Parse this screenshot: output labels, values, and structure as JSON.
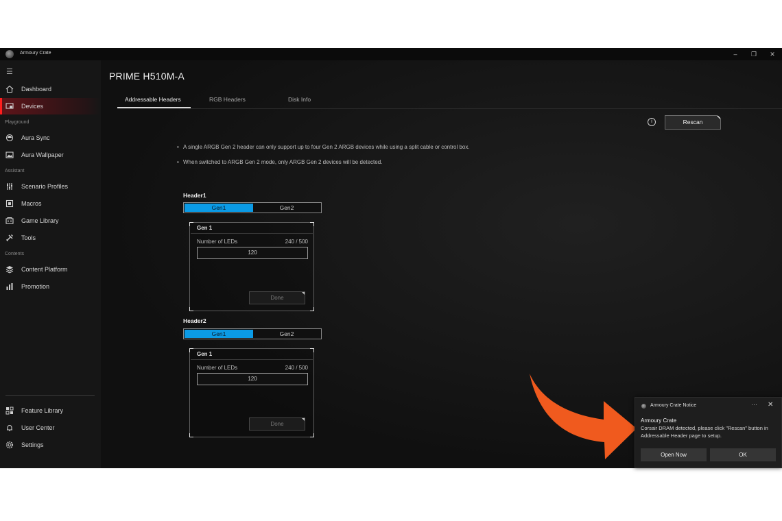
{
  "window": {
    "title": "Armoury Crate",
    "minimize_glyph": "–",
    "maximize_glyph": "❐",
    "close_glyph": "✕"
  },
  "sidebar": {
    "menu_glyph": "☰",
    "items": [
      {
        "label": "Dashboard",
        "icon": "home-icon"
      },
      {
        "label": "Devices",
        "icon": "devices-icon",
        "active": true
      },
      {
        "label": "Aura Sync",
        "icon": "aura-icon"
      },
      {
        "label": "Aura Wallpaper",
        "icon": "wallpaper-icon"
      },
      {
        "label": "Scenario Profiles",
        "icon": "sliders-icon"
      },
      {
        "label": "Macros",
        "icon": "macro-icon"
      },
      {
        "label": "Game Library",
        "icon": "game-library-icon"
      },
      {
        "label": "Tools",
        "icon": "tools-icon"
      },
      {
        "label": "Content Platform",
        "icon": "layers-icon"
      },
      {
        "label": "Promotion",
        "icon": "chart-icon"
      }
    ],
    "sections": [
      "Playground",
      "Assistant",
      "Contents"
    ],
    "bottom_items": [
      {
        "label": "Feature Library",
        "icon": "grid-icon"
      },
      {
        "label": "User Center",
        "icon": "bell-icon"
      },
      {
        "label": "Settings",
        "icon": "gear-icon"
      }
    ]
  },
  "main": {
    "title": "PRIME H510M-A",
    "tabs": [
      "Addressable Headers",
      "RGB Headers",
      "Disk Info"
    ],
    "info_glyph": "i",
    "rescan_label": "Rescan",
    "notes": [
      "A single ARGB Gen 2 header can only support up to four Gen 2 ARGB devices while using a split cable or control box.",
      "When switched to ARGB Gen 2 mode, only ARGB Gen 2 devices will be detected."
    ],
    "headers": [
      {
        "name": "Header1",
        "gen_options": [
          "Gen1",
          "Gen2"
        ],
        "card_title": "Gen 1",
        "leds_label": "Number of LEDs",
        "leds_count": "240 / 500",
        "leds_value": "120",
        "done_label": "Done"
      },
      {
        "name": "Header2",
        "gen_options": [
          "Gen1",
          "Gen2"
        ],
        "card_title": "Gen 1",
        "leds_label": "Number of LEDs",
        "leds_count": "240 / 500",
        "leds_value": "120",
        "done_label": "Done"
      }
    ]
  },
  "notification": {
    "title": "Armoury Crate Notice",
    "more_glyph": "···",
    "close_glyph": "✕",
    "app": "Armoury Crate",
    "message": "Corsair DRAM detected, please click \"Rescan\" button in Addressable Header page to setup.",
    "open_label": "Open Now",
    "ok_label": "OK"
  },
  "colors": {
    "accent_red": "#ff1e1e",
    "gen_selected": "#0b9be6",
    "arrow": "#f05a1e"
  }
}
